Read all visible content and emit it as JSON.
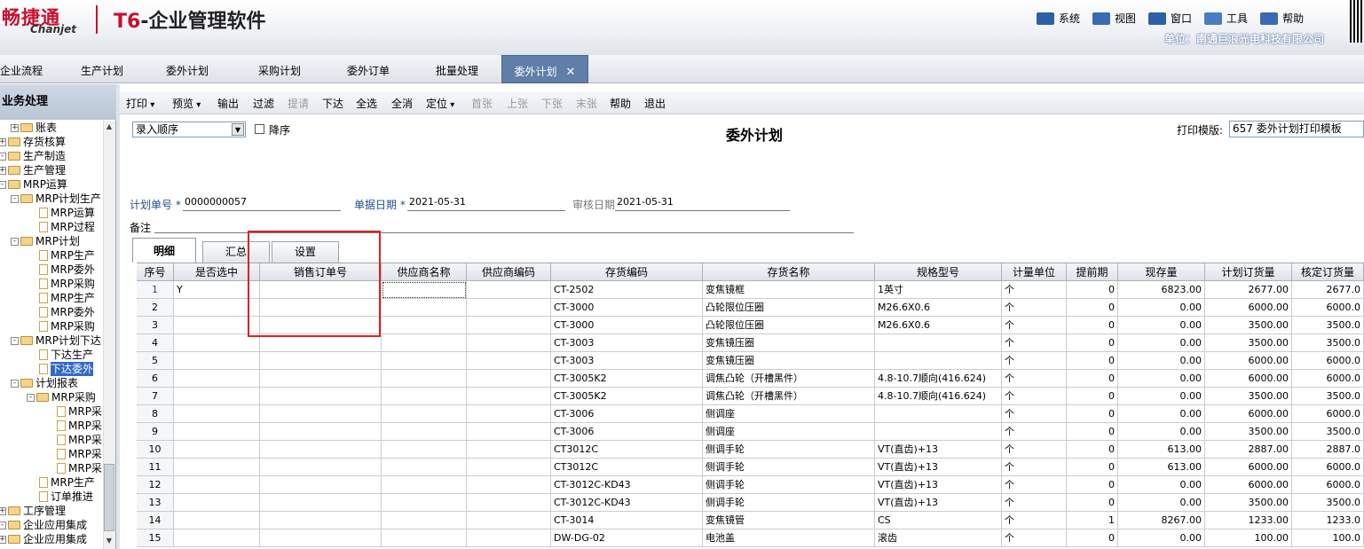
{
  "header": {
    "logo_cn": "畅捷通",
    "logo_en": "Chanjet",
    "product_t6": "T6",
    "product_rest": "-企业管理软件",
    "menu": [
      {
        "label": "系统",
        "icon": "system-icon",
        "color": "#2d5fa8"
      },
      {
        "label": "视图",
        "icon": "view-icon",
        "color": "#3a6ab5"
      },
      {
        "label": "窗口",
        "icon": "window-icon",
        "color": "#2d5fa8"
      },
      {
        "label": "工具",
        "icon": "tools-icon",
        "color": "#4a7cc4"
      },
      {
        "label": "帮助",
        "icon": "help-icon",
        "color": "#3a6ab5"
      }
    ],
    "company": "单位：南通巨浪光电科技有限公司"
  },
  "tabs": [
    "企业流程",
    "生产计划",
    "委外计划",
    "采购计划",
    "委外订单",
    "批量处理",
    "委外计划"
  ],
  "sidebar": {
    "title": "业务处理",
    "items": [
      {
        "label": "账表",
        "type": "folder",
        "pm": "+"
      },
      {
        "label": "存货核算",
        "type": "folder",
        "pm": "+"
      },
      {
        "label": "生产制造",
        "type": "folder",
        "pm": "-"
      },
      {
        "label": "生产管理",
        "type": "folder",
        "pm": "+"
      },
      {
        "label": "MRP运算",
        "type": "folder",
        "pm": "-"
      },
      {
        "label": "MRP计划生产",
        "type": "folder",
        "pm": "-"
      },
      {
        "label": "MRP运算",
        "type": "doc"
      },
      {
        "label": "MRP过程",
        "type": "doc"
      },
      {
        "label": "MRP计划",
        "type": "folder",
        "pm": "-"
      },
      {
        "label": "MRP生产",
        "type": "doc"
      },
      {
        "label": "MRP委外",
        "type": "doc"
      },
      {
        "label": "MRP采购",
        "type": "doc"
      },
      {
        "label": "MRP生产",
        "type": "doc"
      },
      {
        "label": "MRP委外",
        "type": "doc"
      },
      {
        "label": "MRP采购",
        "type": "doc"
      },
      {
        "label": "MRP计划下达",
        "type": "folder",
        "pm": "-"
      },
      {
        "label": "下达生产",
        "type": "doc"
      },
      {
        "label": "下达委外",
        "type": "doc"
      },
      {
        "label": "计划报表",
        "type": "folder",
        "pm": "-"
      },
      {
        "label": "MRP采购",
        "type": "folder",
        "pm": "-"
      },
      {
        "label": "MRP采",
        "type": "doc"
      },
      {
        "label": "MRP采",
        "type": "doc"
      },
      {
        "label": "MRP采",
        "type": "doc"
      },
      {
        "label": "MRP采",
        "type": "doc"
      },
      {
        "label": "MRP采",
        "type": "doc"
      },
      {
        "label": "MRP生产",
        "type": "doc"
      },
      {
        "label": "订单推进",
        "type": "doc"
      },
      {
        "label": "工序管理",
        "type": "folder",
        "pm": "+"
      },
      {
        "label": "企业应用集成",
        "type": "folder",
        "pm": "-"
      },
      {
        "label": "企业应用集成",
        "type": "folder",
        "pm": "+"
      }
    ]
  },
  "toolbar": {
    "buttons": [
      {
        "label": "打印",
        "drop": true,
        "disabled": false
      },
      {
        "label": "预览",
        "drop": true,
        "disabled": false
      },
      {
        "label": "输出",
        "disabled": false
      },
      {
        "label": "过滤",
        "disabled": false
      },
      {
        "label": "提请",
        "disabled": true
      },
      {
        "label": "下达",
        "disabled": false
      },
      {
        "label": "全选",
        "disabled": false
      },
      {
        "label": "全消",
        "disabled": false
      },
      {
        "label": "定位",
        "drop": true,
        "disabled": false
      },
      {
        "label": "首张",
        "disabled": true
      },
      {
        "label": "上张",
        "disabled": true
      },
      {
        "label": "下张",
        "disabled": true
      },
      {
        "label": "末张",
        "disabled": true
      },
      {
        "label": "帮助",
        "disabled": false
      },
      {
        "label": "退出",
        "disabled": false
      }
    ]
  },
  "form": {
    "order_select": "录入顺序",
    "desc_label": "降序",
    "title": "委外计划",
    "print_label": "打印模版:",
    "print_template": "657 委外计划打印模板",
    "plan_no_label": "计划单号",
    "plan_no": "0000000057",
    "doc_date_label": "单据日期",
    "doc_date": "2021-05-31",
    "audit_date_label": "审核日期",
    "audit_date": "2021-05-31",
    "remark_label": "备注",
    "required_mark": "*"
  },
  "subtabs": [
    "明细",
    "汇总",
    "设置"
  ],
  "grid": {
    "columns": [
      "序号",
      "是否选中",
      "销售订单号",
      "供应商名称",
      "供应商编码",
      "存货编码",
      "存货名称",
      "规格型号",
      "计量单位",
      "提前期",
      "现存量",
      "计划订货量",
      "核定订货量"
    ],
    "rows": [
      [
        "1",
        "Y",
        "",
        "",
        "",
        "CT-2502",
        "变焦镜框",
        "1英寸",
        "个",
        "0",
        "6823.00",
        "2677.00",
        "2677.0"
      ],
      [
        "2",
        "",
        "",
        "",
        "",
        "CT-3000",
        "凸轮限位压圈",
        "M26.6X0.6",
        "个",
        "0",
        "0.00",
        "6000.00",
        "6000.0"
      ],
      [
        "3",
        "",
        "",
        "",
        "",
        "CT-3000",
        "凸轮限位压圈",
        "M26.6X0.6",
        "个",
        "0",
        "0.00",
        "3500.00",
        "3500.0"
      ],
      [
        "4",
        "",
        "",
        "",
        "",
        "CT-3003",
        "变焦镜压圈",
        "",
        "个",
        "0",
        "0.00",
        "3500.00",
        "3500.0"
      ],
      [
        "5",
        "",
        "",
        "",
        "",
        "CT-3003",
        "变焦镜压圈",
        "",
        "个",
        "0",
        "0.00",
        "6000.00",
        "6000.0"
      ],
      [
        "6",
        "",
        "",
        "",
        "",
        "CT-3005K2",
        "调焦凸轮（开槽黑件）",
        "4.8-10.7顺向(416.624)",
        "个",
        "0",
        "0.00",
        "6000.00",
        "6000.0"
      ],
      [
        "7",
        "",
        "",
        "",
        "",
        "CT-3005K2",
        "调焦凸轮（开槽黑件）",
        "4.8-10.7顺向(416.624)",
        "个",
        "0",
        "0.00",
        "3500.00",
        "3500.0"
      ],
      [
        "8",
        "",
        "",
        "",
        "",
        "CT-3006",
        "侧调座",
        "",
        "个",
        "0",
        "0.00",
        "6000.00",
        "6000.0"
      ],
      [
        "9",
        "",
        "",
        "",
        "",
        "CT-3006",
        "侧调座",
        "",
        "个",
        "0",
        "0.00",
        "3500.00",
        "3500.0"
      ],
      [
        "10",
        "",
        "",
        "",
        "",
        "CT3012C",
        "侧调手轮",
        "VT(直齿)+13",
        "个",
        "0",
        "613.00",
        "2887.00",
        "2887.0"
      ],
      [
        "11",
        "",
        "",
        "",
        "",
        "CT3012C",
        "侧调手轮",
        "VT(直齿)+13",
        "个",
        "0",
        "613.00",
        "6000.00",
        "6000.0"
      ],
      [
        "12",
        "",
        "",
        "",
        "",
        "CT-3012C-KD43",
        "侧调手轮",
        "VT(直齿)+13",
        "个",
        "0",
        "0.00",
        "6000.00",
        "6000.0"
      ],
      [
        "13",
        "",
        "",
        "",
        "",
        "CT-3012C-KD43",
        "侧调手轮",
        "VT(直齿)+13",
        "个",
        "0",
        "0.00",
        "3500.00",
        "3500.0"
      ],
      [
        "14",
        "",
        "",
        "",
        "",
        "CT-3014",
        "变焦镜管",
        "CS",
        "个",
        "1",
        "8267.00",
        "1233.00",
        "1233.0"
      ],
      [
        "15",
        "",
        "",
        "",
        "",
        "DW-DG-02",
        "电池盖",
        "滚齿",
        "个",
        "0",
        "0.00",
        "100.00",
        "100.0"
      ]
    ]
  }
}
